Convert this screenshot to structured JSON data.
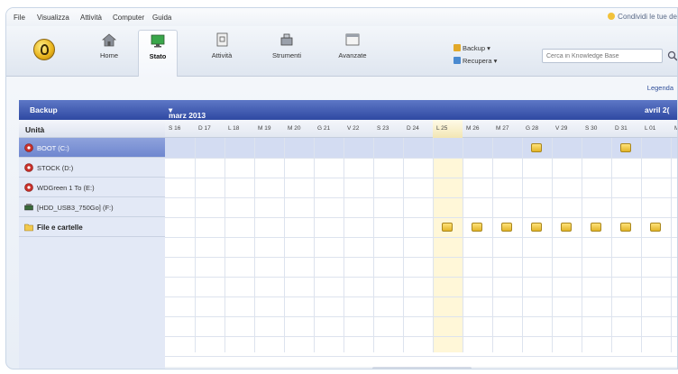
{
  "menu": [
    "File",
    "Visualizza",
    "Attività",
    "Computer",
    "Guida"
  ],
  "promo_text": "Condividi le tue de",
  "toolbar": {
    "buttons": [
      {
        "label": "Home",
        "icon": "home-icon"
      },
      {
        "label": "Stato",
        "icon": "monitor-icon"
      },
      {
        "label": "Attività",
        "icon": "tasks-icon"
      },
      {
        "label": "Strumenti",
        "icon": "tools-icon"
      },
      {
        "label": "Avanzate",
        "icon": "window-icon"
      }
    ],
    "active": "Stato",
    "backup_label": "Backup",
    "restore_label": "Recupera",
    "search_placeholder": "Cerca in Knowledge Base"
  },
  "legend_label": "Legenda",
  "calendar": {
    "section_title": "Backup",
    "month_left": "marz 2013",
    "month_right": "avril 2(",
    "unit_header": "Unità",
    "days": [
      "S 16",
      "D 17",
      "L 18",
      "M 19",
      "M 20",
      "G 21",
      "V 22",
      "S 23",
      "D 24",
      "L 25",
      "M 26",
      "M 27",
      "G 28",
      "V 29",
      "S 30",
      "D 31",
      "L 01",
      "M"
    ],
    "today_index": 9,
    "rows": [
      {
        "label": "BOOT (C:)",
        "icon": "drive-icon",
        "selected": true,
        "events": [
          12,
          15
        ]
      },
      {
        "label": "STOCK (D:)",
        "icon": "drive-icon",
        "selected": false,
        "events": []
      },
      {
        "label": "WDGreen 1 To (E:)",
        "icon": "drive-icon",
        "selected": false,
        "events": []
      },
      {
        "label": "[HDD_USB3_750Go] (F:)",
        "icon": "external-drive-icon",
        "selected": false,
        "events": []
      },
      {
        "label": "File e cartelle",
        "icon": "folder-icon",
        "selected": false,
        "bold": true,
        "events": [
          9,
          10,
          11,
          12,
          13,
          14,
          15,
          16,
          17
        ]
      }
    ]
  },
  "colors": {
    "header_blue": "#2f49a2",
    "selected_row": "#6f87cf",
    "drive_red": "#c8302a",
    "event_yellow": "#e2b528"
  }
}
